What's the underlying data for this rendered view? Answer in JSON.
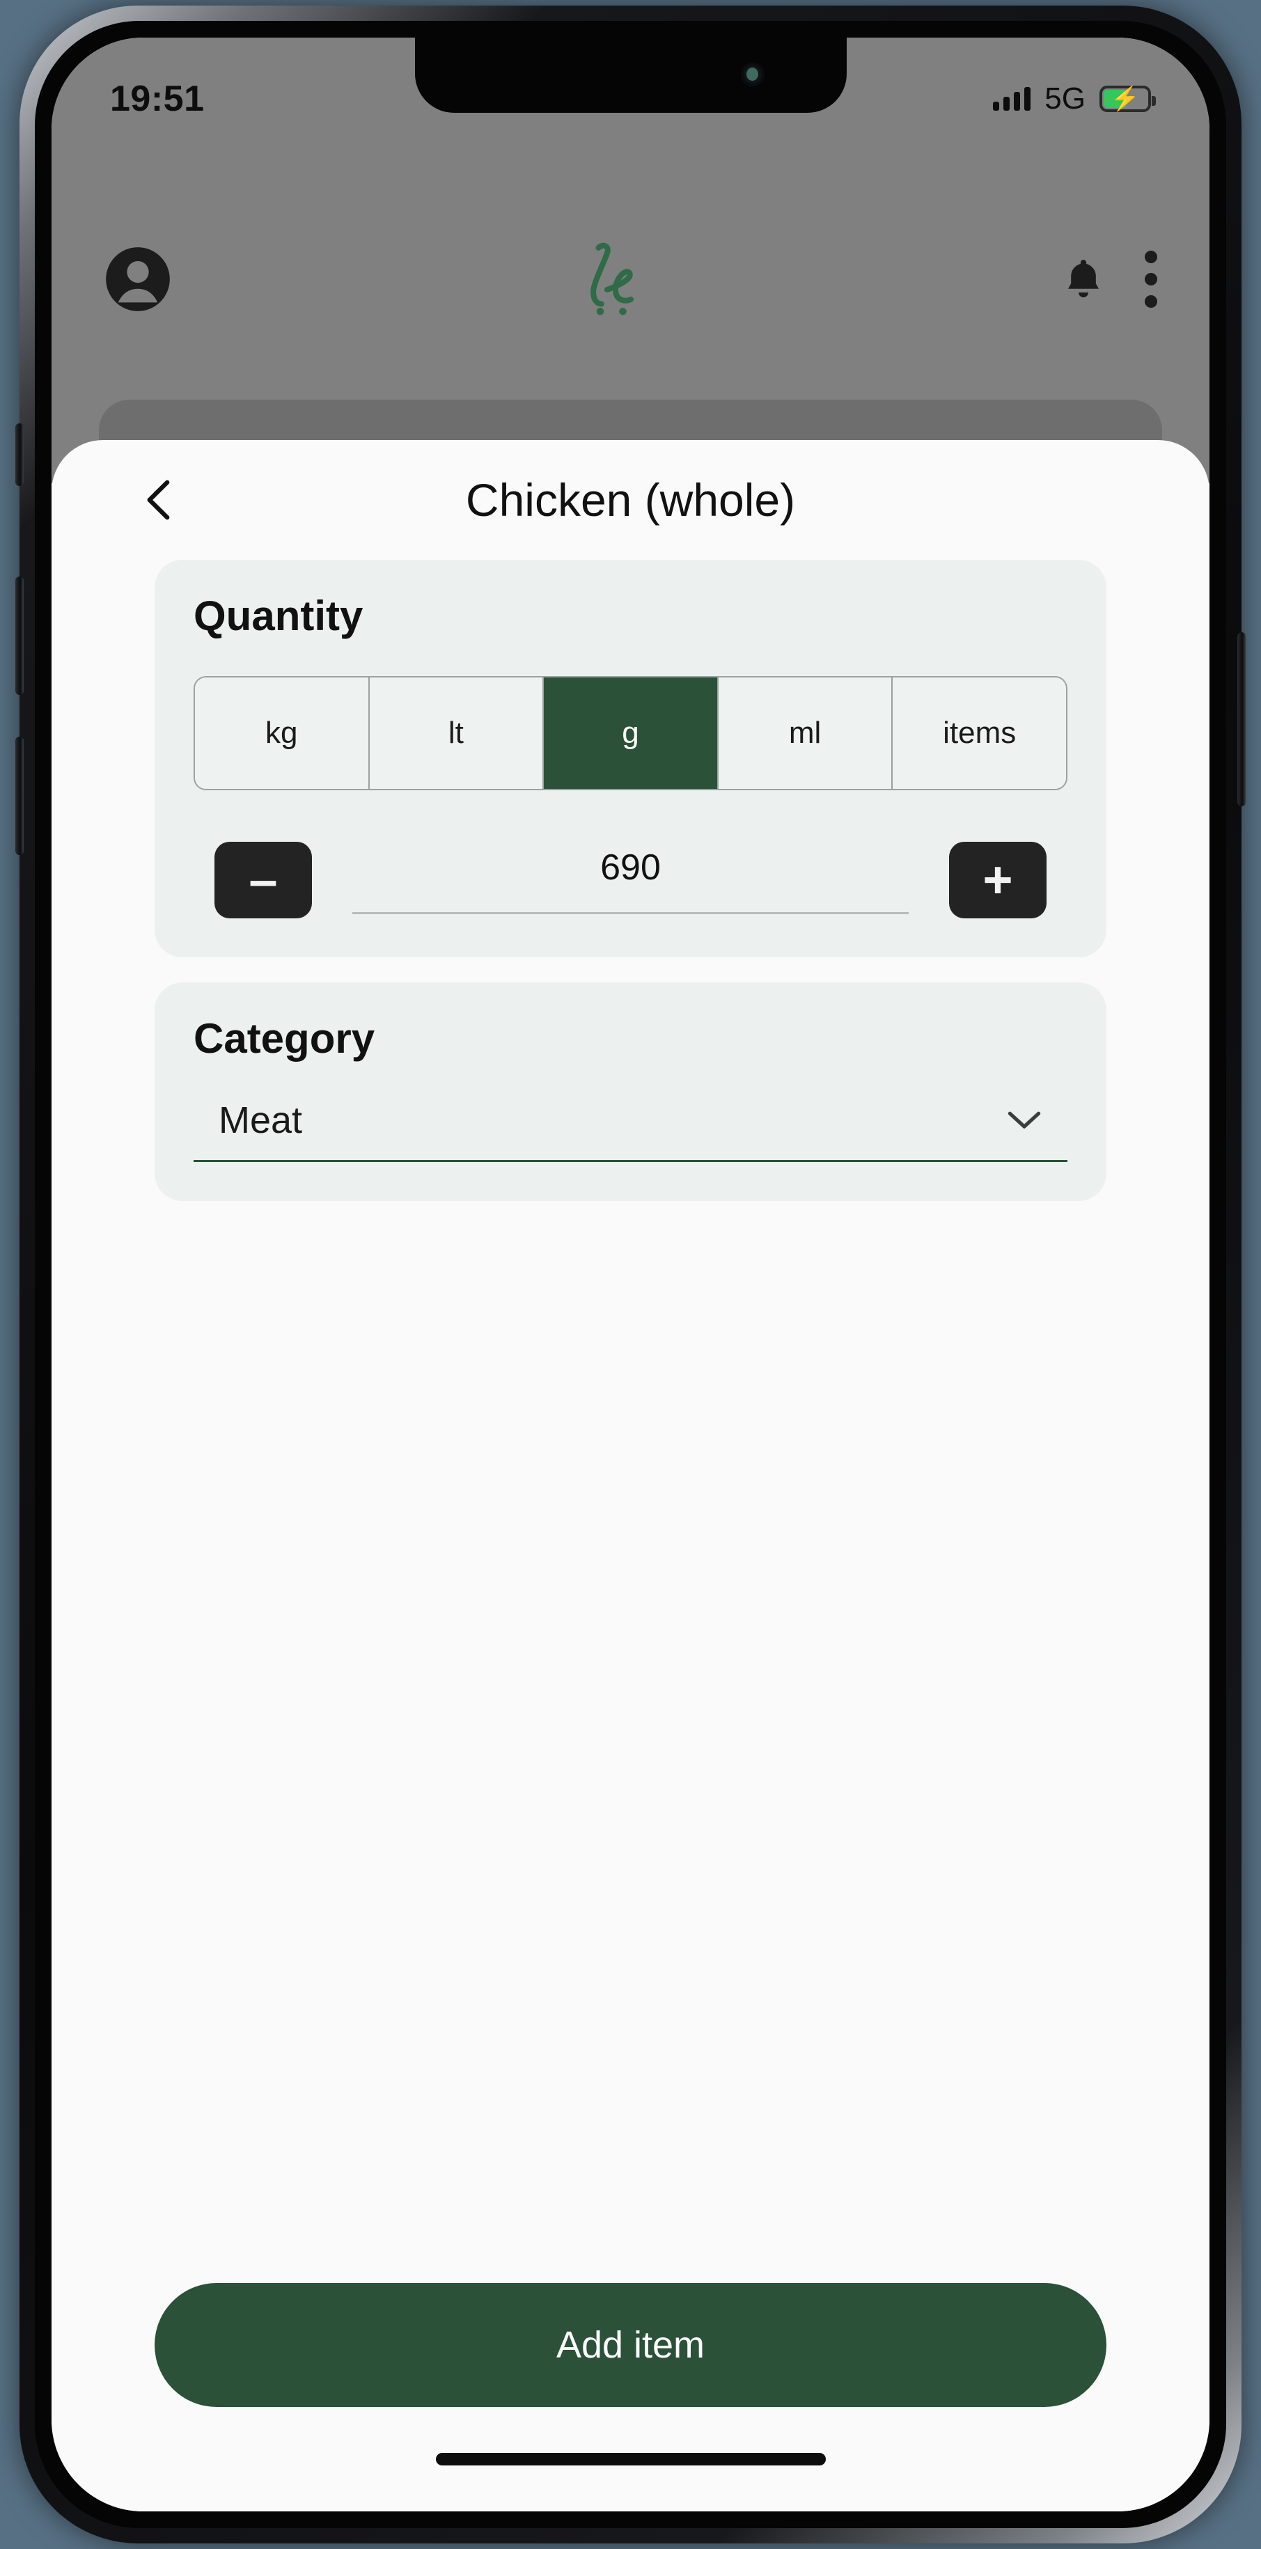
{
  "status_bar": {
    "time": "19:51",
    "network": "5G",
    "signal_icon": "signal-bars-icon",
    "battery_icon": "battery-charging-icon",
    "battery_level_percent": 50,
    "battery_color": "#34c759"
  },
  "app_header": {
    "avatar_icon": "account-circle-icon",
    "logo_icon": "app-logo-script-icon",
    "notifications_icon": "bell-icon",
    "overflow_icon": "kebab-menu-icon"
  },
  "sheet": {
    "back_icon": "chevron-left-icon",
    "title": "Chicken (whole)"
  },
  "quantity": {
    "title": "Quantity",
    "units": [
      {
        "label": "kg",
        "selected": false
      },
      {
        "label": "lt",
        "selected": false
      },
      {
        "label": "g",
        "selected": true
      },
      {
        "label": "ml",
        "selected": false
      },
      {
        "label": "items",
        "selected": false
      }
    ],
    "decrement_label": "–",
    "increment_label": "+",
    "value": "690",
    "placeholder": "0"
  },
  "category": {
    "title": "Category",
    "value": "Meat",
    "chevron_icon": "chevron-down-icon"
  },
  "footer": {
    "add_item_label": "Add item"
  },
  "colors": {
    "brand_green": "#2b5138",
    "card_bg": "#ecf0ef",
    "sheet_bg": "#fafafa",
    "dark_button": "#232323"
  }
}
